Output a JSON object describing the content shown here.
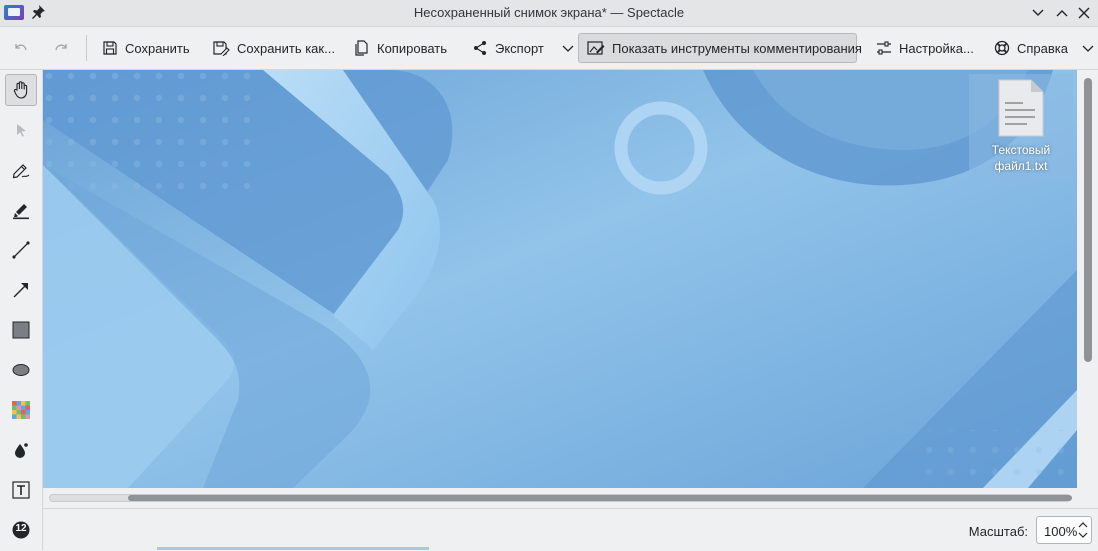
{
  "window": {
    "title": "Несохраненный снимок экрана* — Spectacle"
  },
  "toolbar": {
    "save": "Сохранить",
    "save_as": "Сохранить как...",
    "copy": "Копировать",
    "export": "Экспорт",
    "annotate": "Показать инструменты комментирования",
    "configure": "Настройка...",
    "help": "Справка"
  },
  "desktop": {
    "file_label_line1": "Текстовый",
    "file_label_line2": "файл1.txt"
  },
  "tools": {
    "number_badge": "12"
  },
  "statusbar": {
    "zoom_label": "Масштаб:",
    "zoom_value": "100%"
  },
  "colors": {
    "accent": "#3daee9",
    "wallpaper": "#7fb2df"
  }
}
